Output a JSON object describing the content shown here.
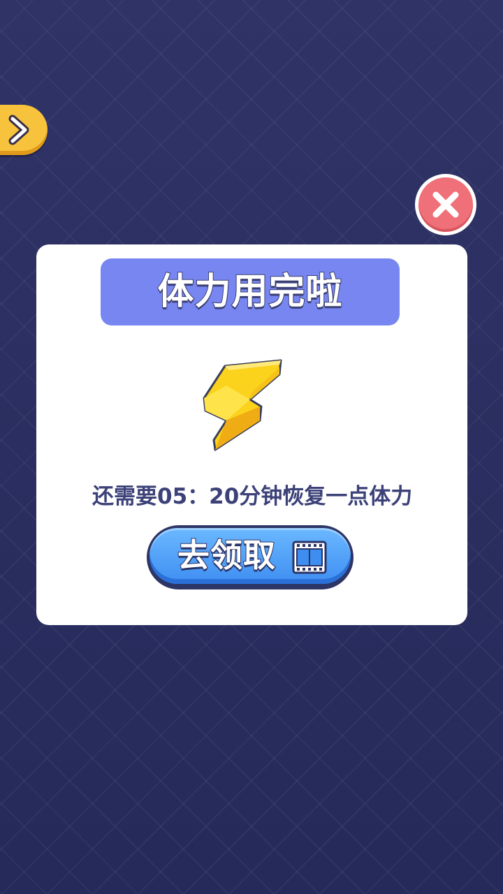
{
  "side_tab": {
    "icon": "chevron-right-icon",
    "color": "#f7c33c"
  },
  "close_button": {
    "icon": "close-icon",
    "color": "#ef7078"
  },
  "dialog": {
    "title": "体力用完啦",
    "title_banner_color": "#7786f1",
    "icon": "lightning-bolt-icon",
    "message": "还需要05：20分钟恢复一点体力",
    "claim_button": {
      "label": "去领取",
      "icon": "video-film-icon",
      "color": "#3e8ef2"
    }
  }
}
